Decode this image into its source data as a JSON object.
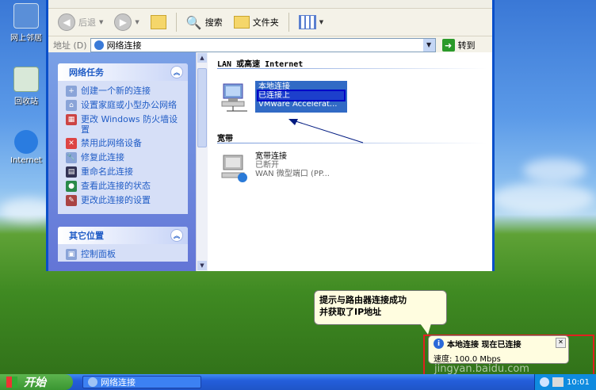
{
  "desktop": {
    "icons": [
      "网上邻居",
      "回收站",
      "Internet"
    ]
  },
  "window": {
    "toolbar": {
      "back": "后退",
      "search": "搜索",
      "folders": "文件夹"
    },
    "address": {
      "label": "地址 (D)",
      "value": "网络连接",
      "go": "转到"
    },
    "tasks": {
      "title": "网络任务",
      "items": [
        "创建一个新的连接",
        "设置家庭或小型办公网络",
        "更改 Windows 防火墙设置",
        "禁用此网络设备",
        "修复此连接",
        "重命名此连接",
        "查看此连接的状态",
        "更改此连接的设置"
      ]
    },
    "other_places": {
      "title": "其它位置",
      "item": "控制面板"
    },
    "lan": {
      "section": "LAN 或高速 Internet",
      "name": "本地连接",
      "status": "已连接上",
      "device": "VMware Accelerat..."
    },
    "broadband": {
      "section": "宽带",
      "name": "宽带连接",
      "status": "已断开",
      "device": "WAN 微型端口 (PP..."
    }
  },
  "annotation": {
    "line1": "提示与路由器连接成功",
    "line2": "并获取了IP地址"
  },
  "notification": {
    "title": "本地连接 现在已连接",
    "speed": "速度: 100.0 Mbps"
  },
  "watermark": "jingyan.baidu.com",
  "taskbar": {
    "start": "开始",
    "task": "网络连接",
    "clock": "10:01"
  }
}
